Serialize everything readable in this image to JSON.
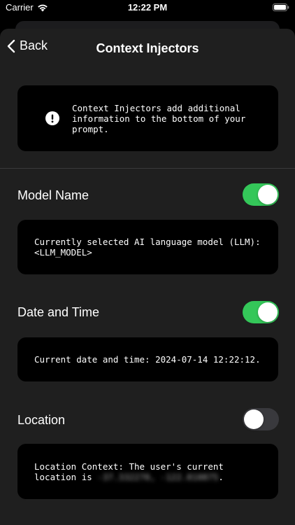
{
  "status_bar": {
    "carrier": "Carrier",
    "time": "12:22 PM"
  },
  "nav": {
    "back_label": "Back",
    "title": "Context Injectors"
  },
  "info_card": {
    "text": "Context Injectors add additional information to the bottom of your prompt."
  },
  "injectors": [
    {
      "label": "Model Name",
      "enabled": true,
      "line1": "Currently selected AI language model (LLM):",
      "line2": "<LLM_MODEL>"
    },
    {
      "label": "Date and Time",
      "enabled": true,
      "line1": "Current date and time: 2024-07-14 12:22:12."
    },
    {
      "label": "Location",
      "enabled": false,
      "line1": "Location Context: The user's current",
      "line2_prefix": "location is",
      "line2_blurred": "-37.332270, -122.010875",
      "line2_suffix": "."
    }
  ],
  "colors": {
    "toggle_on": "#34c759",
    "toggle_off": "#39393d",
    "sheet_background": "#1f1f1f",
    "card_background": "#000000"
  }
}
